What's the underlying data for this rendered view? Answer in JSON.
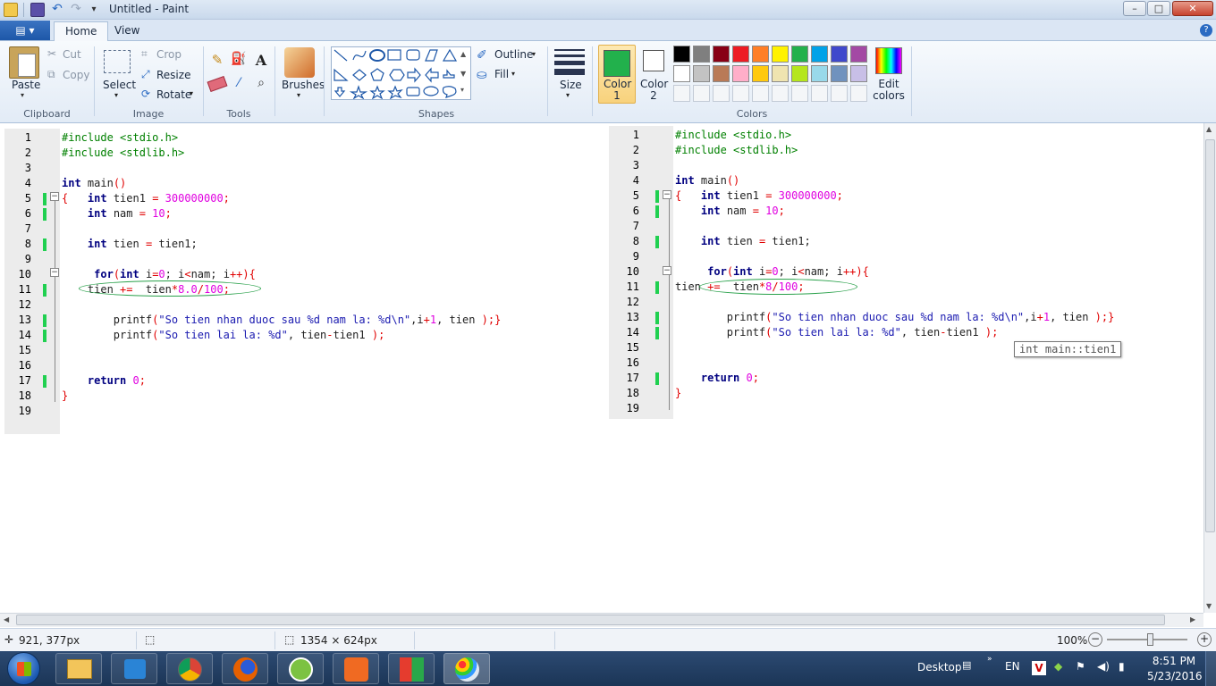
{
  "window": {
    "title": "Untitled - Paint",
    "minimize": "–",
    "maximize": "□",
    "close": "✕"
  },
  "tabs": {
    "file": "▤ ▾",
    "home": "Home",
    "view": "View"
  },
  "clipboard": {
    "paste": "Paste",
    "cut": "Cut",
    "copy": "Copy",
    "label": "Clipboard"
  },
  "image": {
    "select": "Select",
    "crop": "Crop",
    "resize": "Resize",
    "rotate": "Rotate",
    "label": "Image"
  },
  "tools": {
    "label": "Tools"
  },
  "brushes": {
    "label": "Brushes"
  },
  "shapes": {
    "outline": "Outline",
    "fill": "Fill",
    "label": "Shapes"
  },
  "size": {
    "label": "Size"
  },
  "colors": {
    "color1": "Color\n1",
    "color1_a": "Color",
    "color1_b": "1",
    "color2_a": "Color",
    "color2_b": "2",
    "edit_a": "Edit",
    "edit_b": "colors",
    "label": "Colors",
    "color1_value": "#22b14c",
    "row1": [
      "#000000",
      "#7f7f7f",
      "#880015",
      "#ed1c24",
      "#ff7f27",
      "#fff200",
      "#22b14c",
      "#00a2e8",
      "#3f48cc",
      "#a349a4"
    ],
    "row2": [
      "#ffffff",
      "#c3c3c3",
      "#b97a57",
      "#ffaec9",
      "#ffc90e",
      "#efe4b0",
      "#b5e61d",
      "#99d9ea",
      "#7092be",
      "#c8bfe7"
    ]
  },
  "code_left": {
    "line_numbers": [
      "1",
      "2",
      "3",
      "4",
      "5",
      "6",
      "7",
      "8",
      "9",
      "10",
      "11",
      "12",
      "13",
      "14",
      "15",
      "16",
      "17",
      "18",
      "19"
    ]
  },
  "code_right": {
    "line_numbers": [
      "1",
      "2",
      "3",
      "4",
      "5",
      "6",
      "7",
      "8",
      "9",
      "10",
      "11",
      "12",
      "13",
      "14",
      "15",
      "16",
      "17",
      "18",
      "19"
    ],
    "tooltip": "int main::tien1"
  },
  "code_text": {
    "include1": "#include <stdio.h>",
    "include2": "#include <stdlib.h>",
    "int": "int",
    "main": " main",
    "parens": "()",
    "brace_open": "{",
    "brace_close": "}",
    "tien1_decl": " tien1 ",
    "eq": "=",
    "val_300": " 300000000",
    "semi": ";",
    "nam_decl": " nam ",
    "val_10": " 10",
    "tien_decl": " tien ",
    "tien1_ref": " tien1;",
    "for": "for",
    "for_open": "(",
    "for_int": "int",
    "for_i": " i",
    "for_eq": "=",
    "for_zero": "0",
    "for_mid": "; i",
    "for_lt": "<",
    "for_nam": "nam; i",
    "for_inc": "++",
    "for_close": "){",
    "tien_stmt": "tien ",
    "plus_eq": "+=",
    "tien_star": "  tien",
    "star": "*",
    "val_8": "8.0",
    "val_8_right": "8",
    "slash": "/",
    "val_100": "100",
    "printf": "printf",
    "p_open": "(",
    "str1": "\"So tien nhan duoc sau %d nam la: %d\\n\"",
    "comma_i": ",i",
    "plus": "+",
    "one": "1",
    "comma_tien": ", tien ",
    "p_close_semi": ");}",
    "str2": "\"So tien lai la: %d\"",
    "tien_minus": ", tien",
    "minus": "-",
    "tien1_tail": "tien1 ",
    "p_close": ");",
    "return": "return",
    "zero": " 0",
    "semi2": ";"
  },
  "status": {
    "cursor": "921, 377px",
    "dimensions": "1354 × 624px",
    "zoom": "100%"
  },
  "taskbar": {
    "desktop": "Desktop",
    "lang": "EN",
    "time": "8:51 PM",
    "date": "5/23/2016"
  }
}
